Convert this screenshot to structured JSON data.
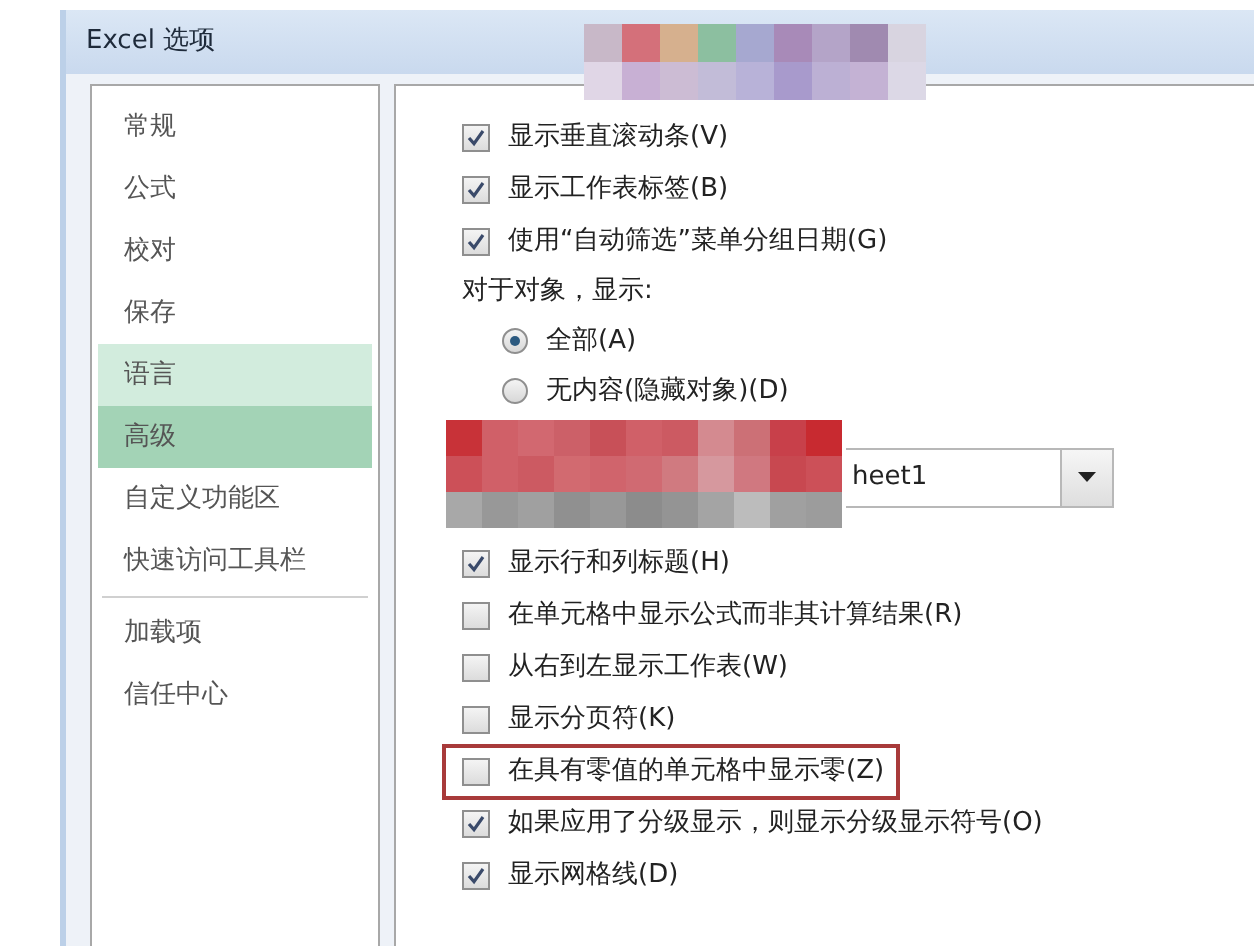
{
  "window": {
    "title": "Excel 选项"
  },
  "sidebar": {
    "items": [
      {
        "label": "常规",
        "selected": false,
        "hovered": false
      },
      {
        "label": "公式",
        "selected": false,
        "hovered": false
      },
      {
        "label": "校对",
        "selected": false,
        "hovered": false
      },
      {
        "label": "保存",
        "selected": false,
        "hovered": false
      },
      {
        "label": "语言",
        "selected": false,
        "hovered": true
      },
      {
        "label": "高级",
        "selected": true,
        "hovered": false
      },
      {
        "label": "自定义功能区",
        "selected": false,
        "hovered": false
      },
      {
        "label": "快速访问工具栏",
        "selected": false,
        "hovered": false,
        "divider_after": true
      },
      {
        "label": "加载项",
        "selected": false,
        "hovered": false
      },
      {
        "label": "信任中心",
        "selected": false,
        "hovered": false
      }
    ]
  },
  "options": [
    {
      "kind": "checkbox",
      "label": "显示垂直滚动条(V)",
      "checked": true
    },
    {
      "kind": "checkbox",
      "label": "显示工作表标签(B)",
      "checked": true
    },
    {
      "kind": "checkbox",
      "label": "使用“自动筛选”菜单分组日期(G)",
      "checked": true
    },
    {
      "kind": "label",
      "label": "对于对象，显示:"
    },
    {
      "kind": "radio",
      "label": "全部(A)",
      "selected": true
    },
    {
      "kind": "radio",
      "label": "无内容(隐藏对象)(D)",
      "selected": false
    },
    {
      "kind": "dropdown",
      "value": "heet1"
    },
    {
      "kind": "checkbox",
      "label": "显示行和列标题(H)",
      "checked": true
    },
    {
      "kind": "checkbox",
      "label": "在单元格中显示公式而非其计算结果(R)",
      "checked": false
    },
    {
      "kind": "checkbox",
      "label": "从右到左显示工作表(W)",
      "checked": false
    },
    {
      "kind": "checkbox",
      "label": "显示分页符(K)",
      "checked": false
    },
    {
      "kind": "checkbox",
      "label": "在具有零值的单元格中显示零(Z)",
      "checked": false,
      "highlighted": true
    },
    {
      "kind": "checkbox",
      "label": "如果应用了分级显示，则显示分级显示符号(O)",
      "checked": true
    },
    {
      "kind": "checkbox",
      "label": "显示网格线(D)",
      "checked": true
    }
  ]
}
